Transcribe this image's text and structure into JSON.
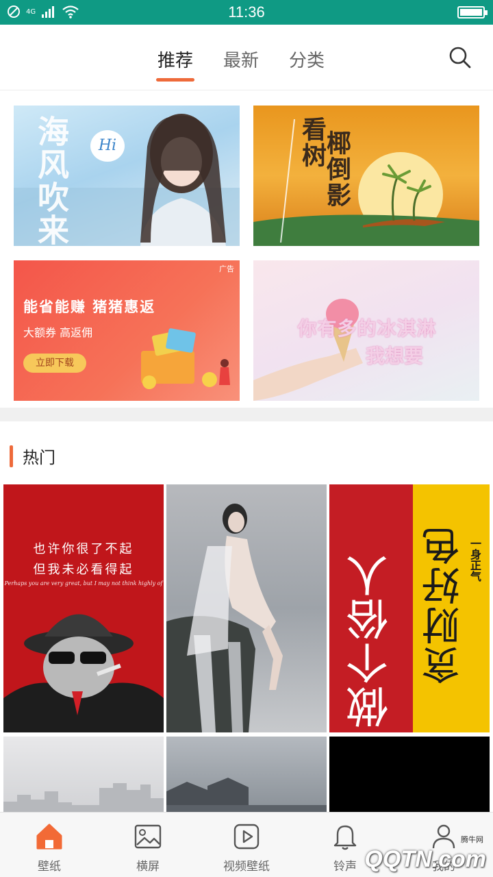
{
  "status_bar": {
    "time": "11:36",
    "network": "4G"
  },
  "header": {
    "tabs": [
      {
        "label": "推荐",
        "active": true
      },
      {
        "label": "最新",
        "active": false
      },
      {
        "label": "分类",
        "active": false
      }
    ],
    "search_icon": "search-icon"
  },
  "banners": {
    "b1": {
      "title": "海风吹来",
      "bubble": "Hi"
    },
    "b2": {
      "title_col1": "看树",
      "title_col2": "椰倒影"
    },
    "b3": {
      "ad_tag": "广告",
      "line1": "能省能赚 猪猪惠返",
      "line2": "大额券 高返佣",
      "button": "立即下载"
    },
    "b4": {
      "line1": "你有多的冰淇淋",
      "line2": "我想要"
    }
  },
  "section": {
    "title": "热门"
  },
  "grid": {
    "t1": {
      "quote1": "也许你很了不起",
      "quote2": "但我未必看得起",
      "quote3": "Perhaps you are very great, but I may not think highly of"
    },
    "t3": {
      "left_text": "做个俗人",
      "right_text": "贪财好色",
      "corner_text": "一身正气"
    }
  },
  "bottom_nav": [
    {
      "label": "壁纸",
      "icon": "home-icon",
      "active": true
    },
    {
      "label": "横屏",
      "icon": "image-icon",
      "active": false
    },
    {
      "label": "视频壁纸",
      "icon": "video-play-icon",
      "active": false
    },
    {
      "label": "铃声",
      "icon": "bell-icon",
      "active": false
    },
    {
      "label": "我的",
      "icon": "profile-icon",
      "active": false
    }
  ],
  "watermark": {
    "brand": "QQTN.com",
    "site": "腾牛网"
  },
  "colors": {
    "accent": "#ee6a3a",
    "status_bar": "#0f9a84"
  }
}
